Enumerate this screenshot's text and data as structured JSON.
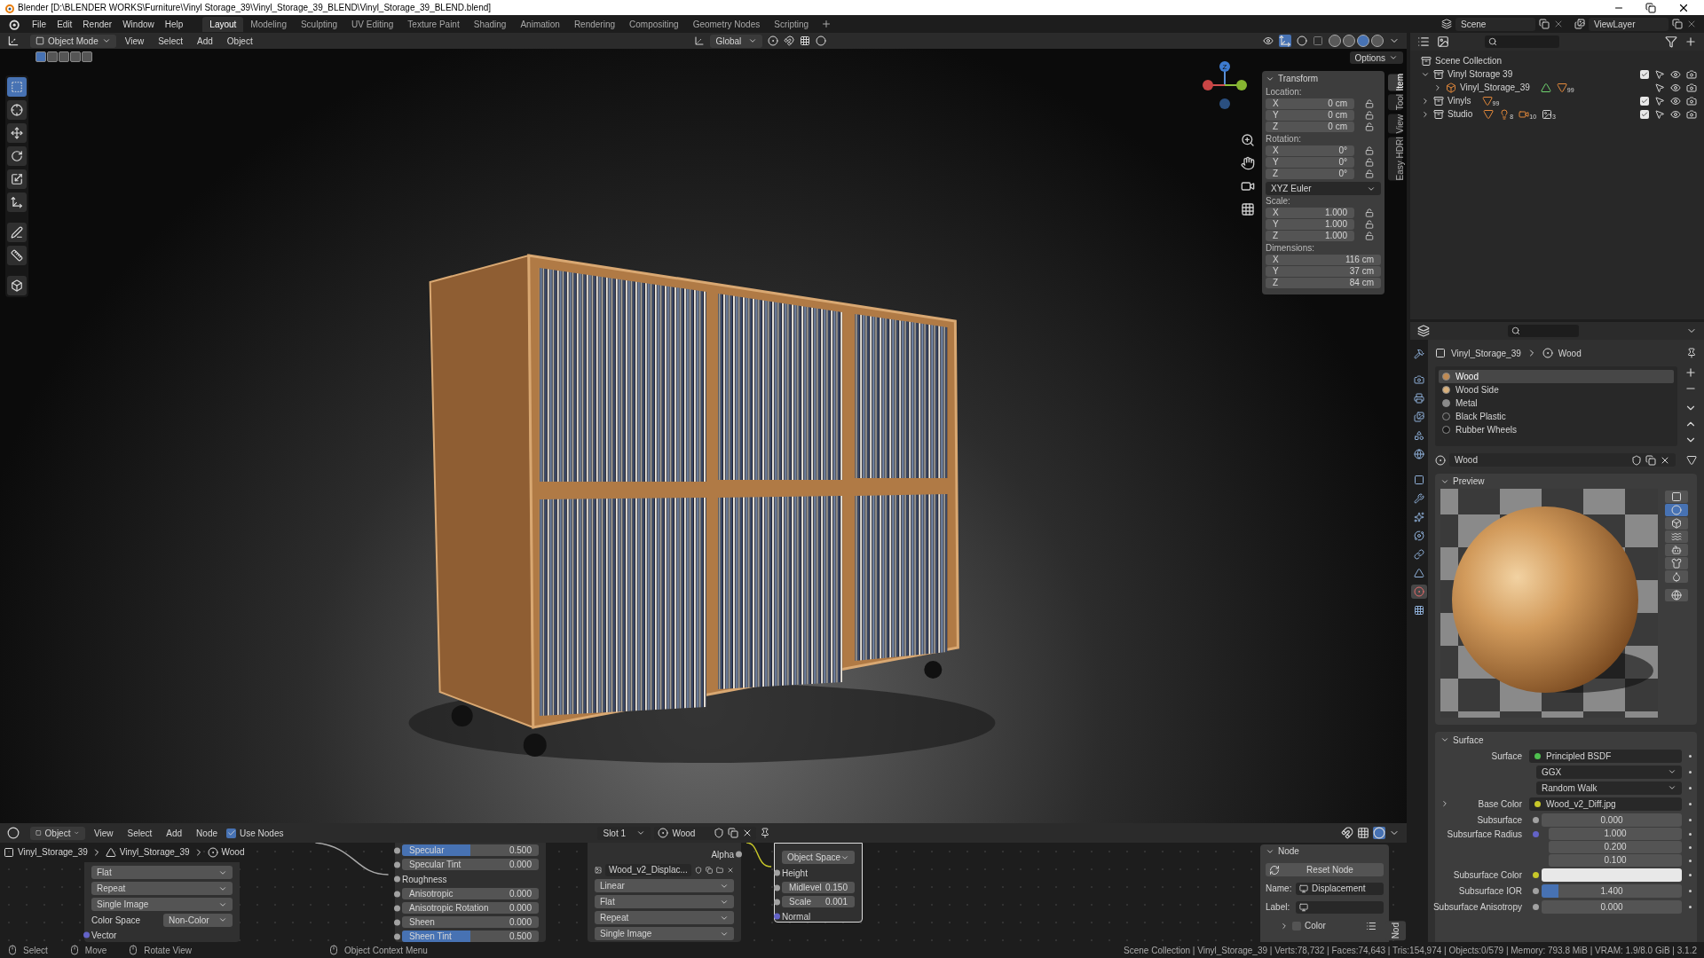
{
  "window": {
    "title": "Blender [D:\\BLENDER WORKS\\Furniture\\Vinyl Storage_39\\Vinyl_Storage_39_BLEND\\Vinyl_Storage_39_BLEND.blend]"
  },
  "menu": [
    "File",
    "Edit",
    "Render",
    "Window",
    "Help"
  ],
  "workspaces": [
    {
      "label": "Layout",
      "selected": true
    },
    {
      "label": "Modeling",
      "selected": false
    },
    {
      "label": "Sculpting",
      "selected": false
    },
    {
      "label": "UV Editing",
      "selected": false
    },
    {
      "label": "Texture Paint",
      "selected": false
    },
    {
      "label": "Shading",
      "selected": false
    },
    {
      "label": "Animation",
      "selected": false
    },
    {
      "label": "Rendering",
      "selected": false
    },
    {
      "label": "Compositing",
      "selected": false
    },
    {
      "label": "Geometry Nodes",
      "selected": false
    },
    {
      "label": "Scripting",
      "selected": false
    }
  ],
  "scene": "Scene",
  "view_layer": "ViewLayer",
  "viewport": {
    "mode": "Object Mode",
    "menus": [
      "View",
      "Select",
      "Add",
      "Object"
    ],
    "orientation": "Global",
    "options": "Options",
    "gizmo_label": "Z",
    "select_modes": [
      {
        "selected": true
      },
      {
        "selected": false
      },
      {
        "selected": false
      },
      {
        "selected": false
      },
      {
        "selected": false
      }
    ],
    "shading_modes": [
      {
        "selected": false
      },
      {
        "selected": false
      },
      {
        "selected": true
      },
      {
        "selected": false
      }
    ],
    "tools": [
      {
        "kind": "select",
        "selected": true
      },
      {
        "kind": "cursor",
        "selected": false
      },
      {
        "kind": "move",
        "selected": false
      },
      {
        "kind": "rotate",
        "selected": false
      },
      {
        "kind": "scale",
        "selected": false
      },
      {
        "kind": "transform",
        "selected": false
      },
      {
        "kind": "annotate",
        "selected": false
      },
      {
        "kind": "measure",
        "selected": false
      },
      {
        "kind": "add_cube",
        "selected": false
      }
    ]
  },
  "transform": {
    "title": "Transform",
    "groups": [
      {
        "label": "Location:",
        "locks": true,
        "rows": [
          {
            "axis": "X",
            "value": "0 cm"
          },
          {
            "axis": "Y",
            "value": "0 cm"
          },
          {
            "axis": "Z",
            "value": "0 cm"
          }
        ]
      },
      {
        "label": "Rotation:",
        "locks": true,
        "mode": "XYZ Euler",
        "rows": [
          {
            "axis": "X",
            "value": "0°"
          },
          {
            "axis": "Y",
            "value": "0°"
          },
          {
            "axis": "Z",
            "value": "0°"
          }
        ]
      },
      {
        "label": "Scale:",
        "locks": true,
        "rows": [
          {
            "axis": "X",
            "value": "1.000"
          },
          {
            "axis": "Y",
            "value": "1.000"
          },
          {
            "axis": "Z",
            "value": "1.000"
          }
        ]
      },
      {
        "label": "Dimensions:",
        "locks": false,
        "rows": [
          {
            "axis": "X",
            "value": "116 cm"
          },
          {
            "axis": "Y",
            "value": "37 cm"
          },
          {
            "axis": "Z",
            "value": "84 cm"
          }
        ]
      }
    ]
  },
  "sidebar_tabs": [
    {
      "label": "Item",
      "selected": true
    },
    {
      "label": "Tool",
      "selected": false
    },
    {
      "label": "View",
      "selected": false
    },
    {
      "label": "Easy HDRI",
      "selected": false
    }
  ],
  "outliner": {
    "root": "Scene Collection",
    "items": [
      {
        "name": "Vinyl Storage 39",
        "expanded": true,
        "checked": true,
        "children": [
          {
            "name": "Vinyl_Storage_39",
            "expanded": false,
            "badges": [
              {
                "kind": "mesh"
              },
              {
                "kind": "material",
                "count": "99"
              }
            ]
          }
        ]
      },
      {
        "name": "Vinyls",
        "expanded": false,
        "checked": true,
        "badges": [
          {
            "kind": "material",
            "count": "99"
          }
        ]
      },
      {
        "name": "Studio",
        "expanded": false,
        "checked": true,
        "badges": [
          {
            "kind": "material"
          },
          {
            "kind": "light",
            "count": "8"
          },
          {
            "kind": "camera",
            "count": "10"
          },
          {
            "kind": "image",
            "count": "3"
          }
        ]
      }
    ]
  },
  "properties": {
    "tabs": [
      {
        "kind": "tool",
        "selected": false
      },
      {
        "kind": "render",
        "selected": false
      },
      {
        "kind": "output",
        "selected": false
      },
      {
        "kind": "view_layer",
        "selected": false
      },
      {
        "kind": "scene",
        "selected": false
      },
      {
        "kind": "world",
        "selected": false
      },
      {
        "kind": "object",
        "selected": false
      },
      {
        "kind": "modifiers",
        "selected": false
      },
      {
        "kind": "particles",
        "selected": false
      },
      {
        "kind": "physics",
        "selected": false
      },
      {
        "kind": "constraints",
        "selected": false
      },
      {
        "kind": "data",
        "selected": false
      },
      {
        "kind": "material",
        "selected": true
      },
      {
        "kind": "texture",
        "selected": false
      }
    ],
    "breadcrumb": [
      "Vinyl_Storage_39",
      "Wood"
    ],
    "materials": [
      {
        "name": "Wood",
        "selected": true,
        "color": "#c08a52"
      },
      {
        "name": "Wood Side",
        "selected": false,
        "color": "#d8b07c"
      },
      {
        "name": "Metal",
        "selected": false,
        "color": "#8a8a8a"
      },
      {
        "name": "Black Plastic",
        "selected": false,
        "color": "#2a2a2a"
      },
      {
        "name": "Rubber Wheels",
        "selected": false,
        "color": "#1a1a1a"
      }
    ],
    "material_name": "Wood",
    "preview": {
      "title": "Preview",
      "expanded": true,
      "shapes": [
        {
          "kind": "plane",
          "selected": false
        },
        {
          "kind": "sphere",
          "selected": true
        },
        {
          "kind": "cube",
          "selected": false
        },
        {
          "kind": "hair",
          "selected": false
        },
        {
          "kind": "monkey",
          "selected": false
        },
        {
          "kind": "cloth",
          "selected": false
        },
        {
          "kind": "fluid",
          "selected": false
        }
      ]
    },
    "surface": {
      "title": "Surface",
      "expanded": true,
      "rows": [
        {
          "kind": "link",
          "label": "Surface",
          "value": "Principled BSDF",
          "color": "#4fc04f"
        },
        {
          "kind": "dropdown",
          "value": "GGX"
        },
        {
          "kind": "dropdown",
          "value": "Random Walk"
        },
        {
          "kind": "link",
          "label": "Base Color",
          "value": "Wood_v2_Diff.jpg",
          "color": "#c7c729",
          "expanded": false
        },
        {
          "kind": "number",
          "label": "Subsurface",
          "value": "0.000",
          "color": "#a1a1a1"
        },
        {
          "kind": "vector",
          "label": "Subsurface Radius",
          "values": [
            "1.000",
            "0.200",
            "0.100"
          ],
          "color": "#6363c7"
        },
        {
          "kind": "swatch",
          "label": "Subsurface Color",
          "color": "#e8e8e8"
        },
        {
          "kind": "slider",
          "label": "Subsurface IOR",
          "value": "1.400",
          "level": 0.12,
          "color": "#a1a1a1"
        },
        {
          "kind": "number",
          "label": "Subsurface Anisotropy",
          "value": "0.000",
          "color": "#a1a1a1"
        }
      ]
    }
  },
  "node_editor": {
    "editor": "Object",
    "menus": [
      "View",
      "Select",
      "Add",
      "Node"
    ],
    "use_nodes": {
      "label": "Use Nodes",
      "checked": true
    },
    "slot": "Slot 1",
    "material": "Wood",
    "breadcrumb": [
      "Vinyl_Storage_39",
      "Vinyl_Storage_39",
      "Wood"
    ],
    "nodes": [
      {
        "rows": [
          {
            "kind": "dropdown",
            "value": "Flat"
          },
          {
            "kind": "dropdown",
            "value": "Repeat"
          },
          {
            "kind": "dropdown",
            "value": "Single Image"
          },
          {
            "kind": "choice",
            "label": "Color Space",
            "value": "Non-Color"
          },
          {
            "kind": "input",
            "label": "Vector",
            "color": "#6363c7"
          }
        ]
      },
      {
        "rows": [
          {
            "kind": "slider",
            "label": "Specular",
            "value": "0.500",
            "level": 0.5,
            "color": "#a1a1a1"
          },
          {
            "kind": "number",
            "label": "Specular Tint",
            "value": "0.000",
            "color": "#a1a1a1"
          },
          {
            "kind": "input",
            "label": "Roughness",
            "color": "#a1a1a1"
          },
          {
            "kind": "number",
            "label": "Anisotropic",
            "value": "0.000",
            "color": "#a1a1a1"
          },
          {
            "kind": "number",
            "label": "Anisotropic Rotation",
            "value": "0.000",
            "color": "#a1a1a1"
          },
          {
            "kind": "number",
            "label": "Sheen",
            "value": "0.000",
            "color": "#a1a1a1"
          },
          {
            "kind": "slider",
            "label": "Sheen Tint",
            "value": "0.500",
            "level": 0.5,
            "color": "#a1a1a1"
          }
        ]
      },
      {
        "rows": [
          {
            "kind": "output",
            "label": "Alpha",
            "color": "#a1a1a1"
          },
          {
            "kind": "image",
            "value": "Wood_v2_Displac..."
          },
          {
            "kind": "dropdown",
            "value": "Linear"
          },
          {
            "kind": "dropdown",
            "value": "Flat"
          },
          {
            "kind": "dropdown",
            "value": "Repeat"
          },
          {
            "kind": "dropdown",
            "value": "Single Image"
          }
        ]
      },
      {
        "rows": [
          {
            "kind": "dropdown",
            "value": "Object Space"
          },
          {
            "kind": "input",
            "label": "Height",
            "color": "#a1a1a1"
          },
          {
            "kind": "number",
            "label": "Midlevel",
            "value": "0.150",
            "color": "#a1a1a1"
          },
          {
            "kind": "number",
            "label": "Scale",
            "value": "0.001",
            "color": "#a1a1a1"
          },
          {
            "kind": "input",
            "label": "Normal",
            "color": "#6363c7"
          }
        ]
      }
    ],
    "panel": {
      "title": "Node",
      "reset": "Reset Node",
      "name_label": "Name:",
      "name": "Displacement",
      "label_label": "Label:",
      "color_label": "Color",
      "color_checked": false,
      "tab": "Nod"
    }
  },
  "status_bar": {
    "hints": [
      "Select",
      "Move",
      "Rotate View",
      "Object Context Menu"
    ],
    "stats": "Scene Collection | Vinyl_Storage_39 | Verts:78,732 | Faces:74,643 | Tris:154,974 | Objects:0/579 | Memory: 793.8 MiB | VRAM: 1.9/8.0 GiB | 3.1.2"
  }
}
